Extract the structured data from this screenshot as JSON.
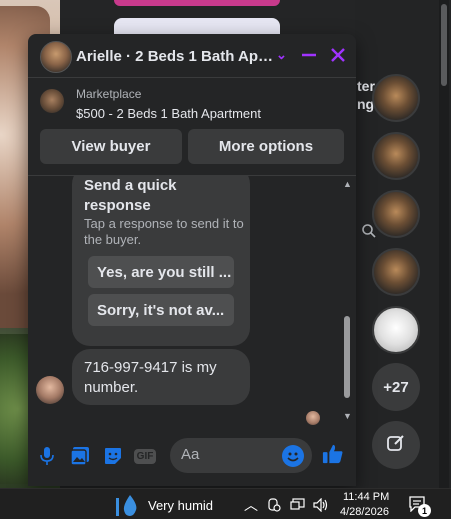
{
  "chat": {
    "title": "Arielle · 2 Beds 1 Bath Apa...",
    "minimize_icon": "minus-icon",
    "close_icon": "close-icon",
    "accent_color": "#a033ff"
  },
  "listing": {
    "source": "Marketplace",
    "name": "$500 - 2 Beds 1 Bath Apartment",
    "view_buyer_label": "View buyer",
    "more_options_label": "More options"
  },
  "quick_response": {
    "title": "Send a quick response",
    "subtitle": "Tap a response to send it to the buyer.",
    "options": [
      "Yes, are you still ...",
      "Sorry, it's not av..."
    ]
  },
  "messages": [
    {
      "text": "716-997-9417 is my number."
    }
  ],
  "composer": {
    "placeholder": "Aa",
    "icons": [
      "microphone-icon",
      "image-icon",
      "sticker-icon",
      "gif-icon",
      "emoji-icon",
      "thumbs-up-icon"
    ],
    "gif_label": "GIF",
    "like_color": "#1b74e4"
  },
  "background": {
    "partial_text_1": "ter",
    "partial_text_2": "ng",
    "more_count": "+27"
  },
  "taskbar": {
    "weather": "Very humid",
    "time": "11:44 PM",
    "date": "4/28/2026",
    "notification_count": "1"
  }
}
